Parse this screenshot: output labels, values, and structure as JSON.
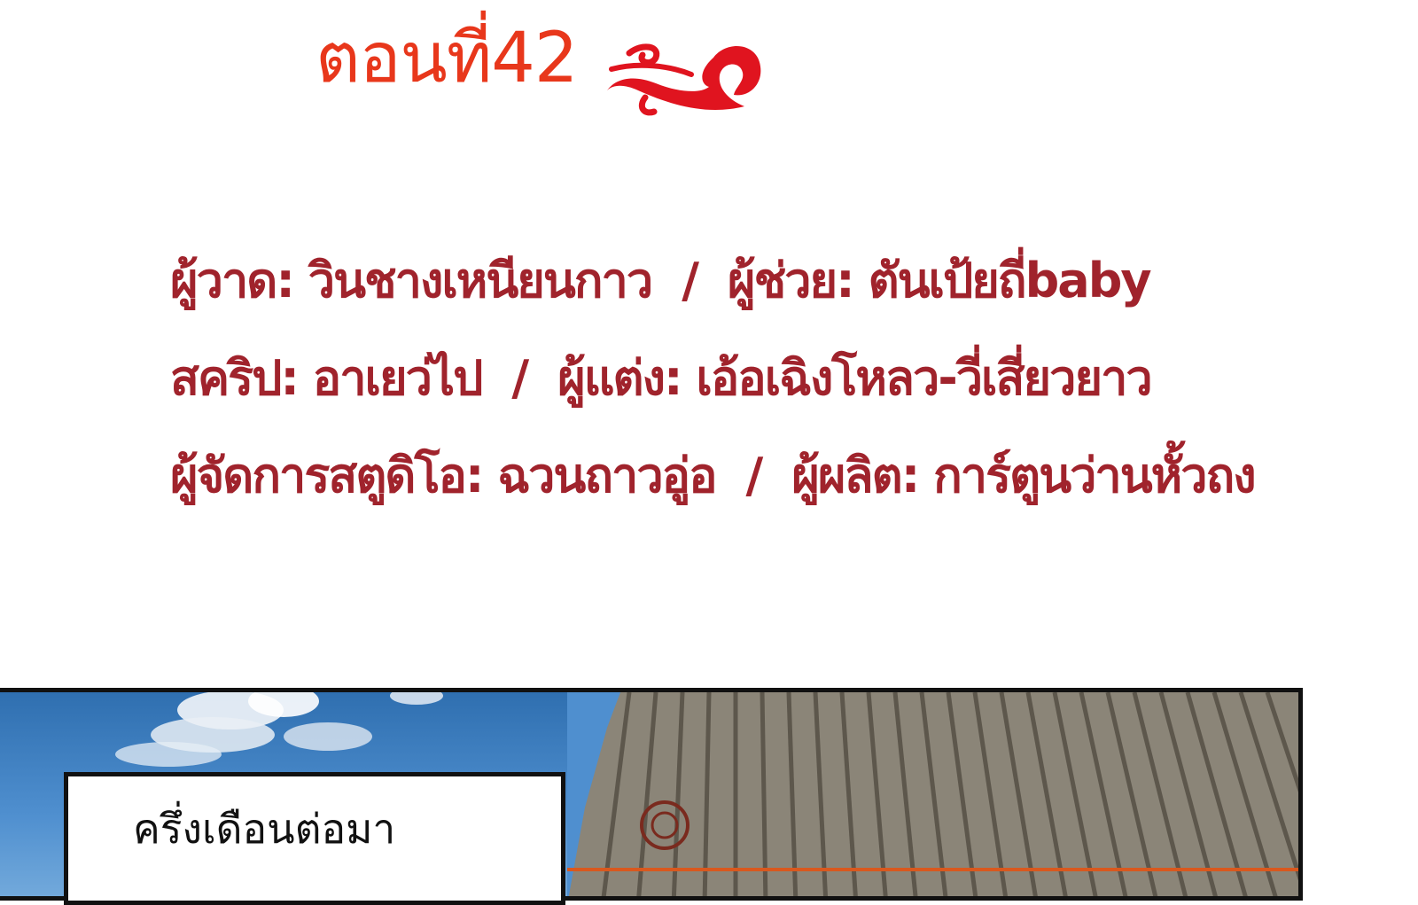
{
  "header": {
    "chapter_title": "ตอนที่42",
    "ornament": "red-cloud-swirl-icon"
  },
  "credits": [
    {
      "left": "ผู้วาด: วินชางเหนียนกาว",
      "separator": "/",
      "right": "ผู้ช่วย: ตันเป้ยถี่baby"
    },
    {
      "left": "สคริป: อาเยว่ไป",
      "separator": "/",
      "right": "ผู้แต่ง: เอ้อเฉิงโหลว-วี่เสี่ยวยาว"
    },
    {
      "left": "ผู้จัดการสตูดิโอ: ฉวนถาวอู่อ",
      "separator": "/",
      "right": "ผู้ผลิต: การ์ตูนว่านหั้วถง"
    }
  ],
  "panel": {
    "caption": "ครึ่งเดือนต่อมา",
    "scene": "sky-and-palace-roof"
  },
  "colors": {
    "title": "#e8371b",
    "credits": "#a0232c",
    "ornament": "#e0141f"
  }
}
